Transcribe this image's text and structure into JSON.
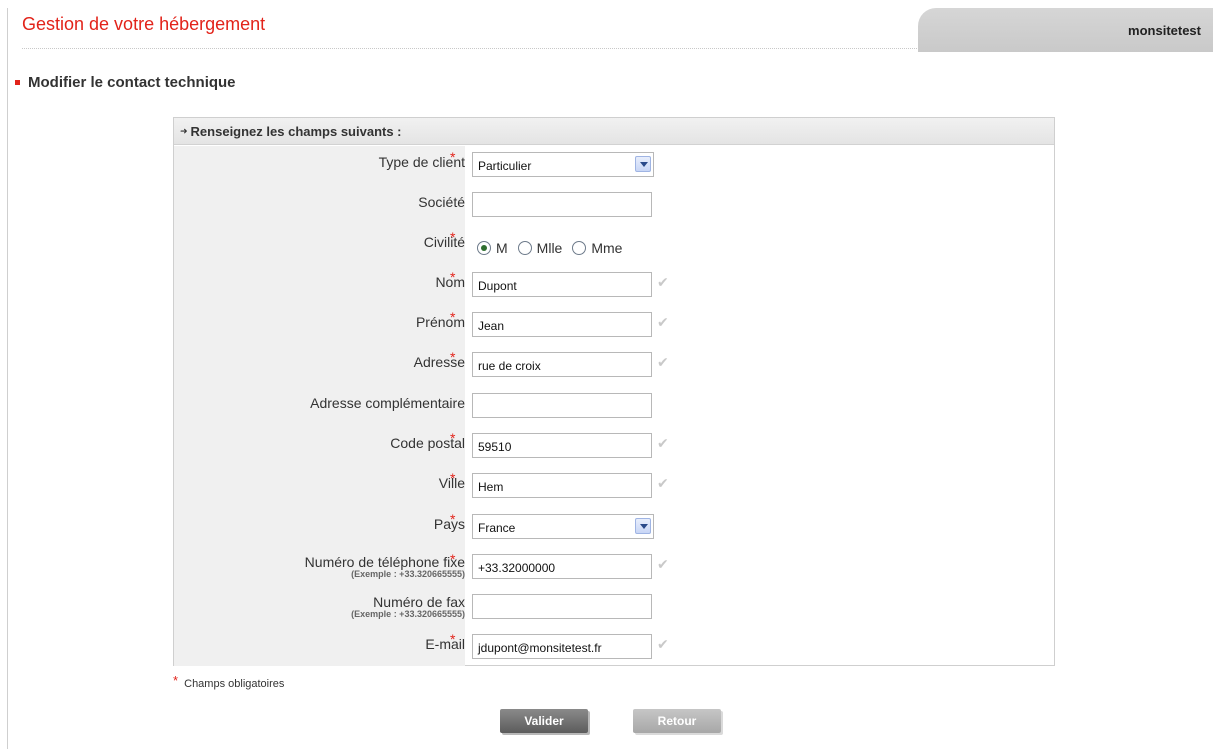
{
  "header": {
    "title": "Gestion de votre hébergement",
    "site_name": "monsitetest"
  },
  "section": {
    "title": "Modifier le contact technique"
  },
  "form": {
    "header": "Renseignez les champs suivants :",
    "required_mark": "*",
    "fields": {
      "type_client": {
        "label": "Type de client",
        "value": "Particulier"
      },
      "societe": {
        "label": "Société",
        "value": ""
      },
      "civilite": {
        "label": "Civilité",
        "options": [
          "M",
          "Mlle",
          "Mme"
        ],
        "selected": "M"
      },
      "nom": {
        "label": "Nom",
        "value": "Dupont"
      },
      "prenom": {
        "label": "Prénom",
        "value": "Jean"
      },
      "adresse": {
        "label": "Adresse",
        "value": "rue de croix"
      },
      "adresse_comp": {
        "label": "Adresse complémentaire",
        "value": ""
      },
      "code_postal": {
        "label": "Code postal",
        "value": "59510"
      },
      "ville": {
        "label": "Ville",
        "value": "Hem"
      },
      "pays": {
        "label": "Pays",
        "value": "France"
      },
      "tel": {
        "label": "Numéro de téléphone fixe",
        "hint": "(Exemple : +33.320665555)",
        "value": "+33.32000000"
      },
      "fax": {
        "label": "Numéro de fax",
        "hint": "(Exemple : +33.320665555)",
        "value": ""
      },
      "email": {
        "label": "E-mail",
        "value": "jdupont@monsitetest.fr"
      }
    }
  },
  "footer": {
    "mandatory_star": "*",
    "mandatory_note": "Champs obligatoires",
    "valider_label": "Valider",
    "retour_label": "Retour"
  },
  "colors": {
    "accent": "#e2231a",
    "label_bg": "#f0f0f0"
  },
  "icons": {
    "arrow": "arrow-right-icon",
    "check": "checkmark-icon",
    "dropdown": "chevron-down-icon"
  }
}
